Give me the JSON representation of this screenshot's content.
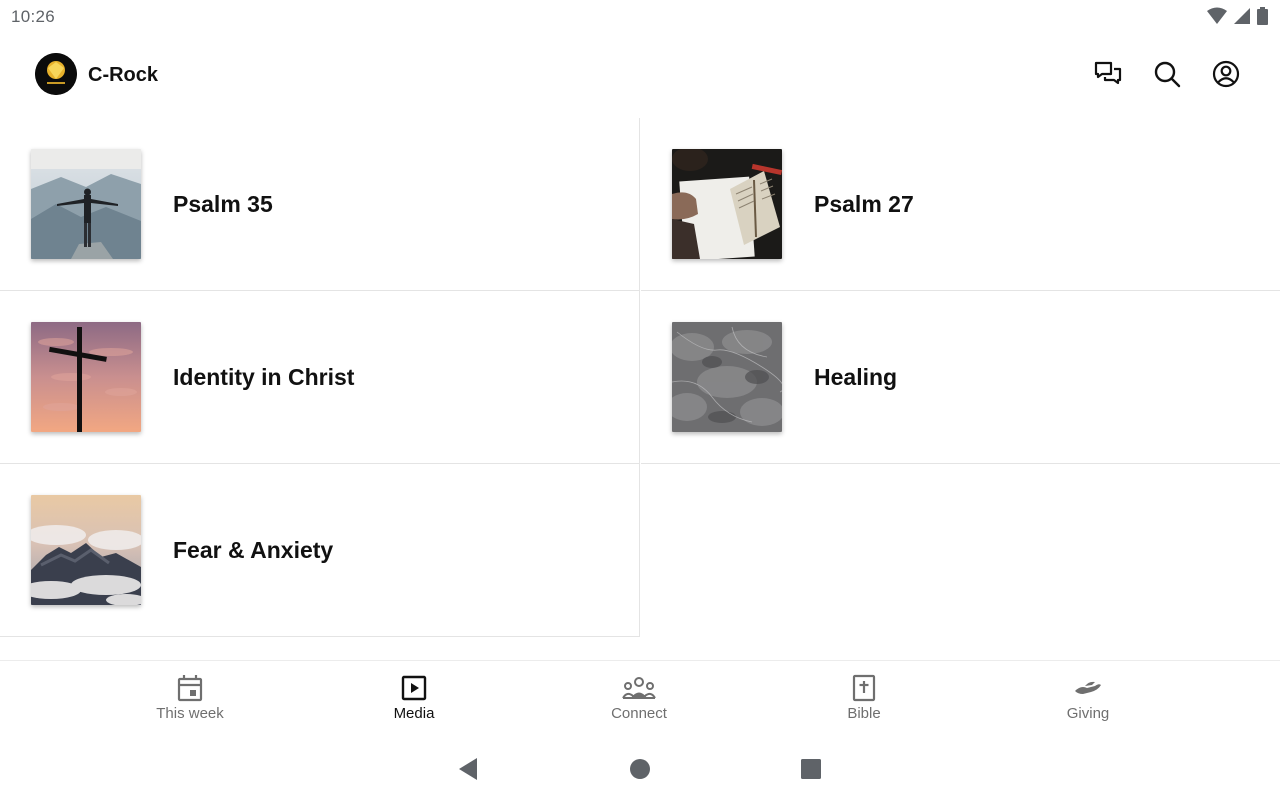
{
  "status_bar": {
    "time": "10:26",
    "icons": [
      "wifi-icon",
      "signal-icon",
      "battery-icon"
    ]
  },
  "app_bar": {
    "title": "C-Rock",
    "logo": "c-rock-logo",
    "actions": [
      "chat-icon",
      "search-icon",
      "account-icon"
    ]
  },
  "media": {
    "items": [
      {
        "label": "Psalm 35",
        "image": "person-on-mountain"
      },
      {
        "label": "Psalm 27",
        "image": "open-bible-desk"
      },
      {
        "label": "Identity in Christ",
        "image": "cross-at-sunset"
      },
      {
        "label": "Healing",
        "image": "gray-marble-texture"
      },
      {
        "label": "Fear & Anxiety",
        "image": "clouds-over-peaks"
      }
    ]
  },
  "bottom_nav": {
    "active": "Media",
    "items": [
      {
        "label": "This week",
        "icon": "calendar-icon"
      },
      {
        "label": "Media",
        "icon": "play-icon"
      },
      {
        "label": "Connect",
        "icon": "group-icon"
      },
      {
        "label": "Bible",
        "icon": "bible-icon"
      },
      {
        "label": "Giving",
        "icon": "giving-hand-icon"
      }
    ]
  },
  "colors": {
    "text": "#111111",
    "nav_inactive": "#6f6f6f",
    "divider": "#e4e4e4"
  }
}
